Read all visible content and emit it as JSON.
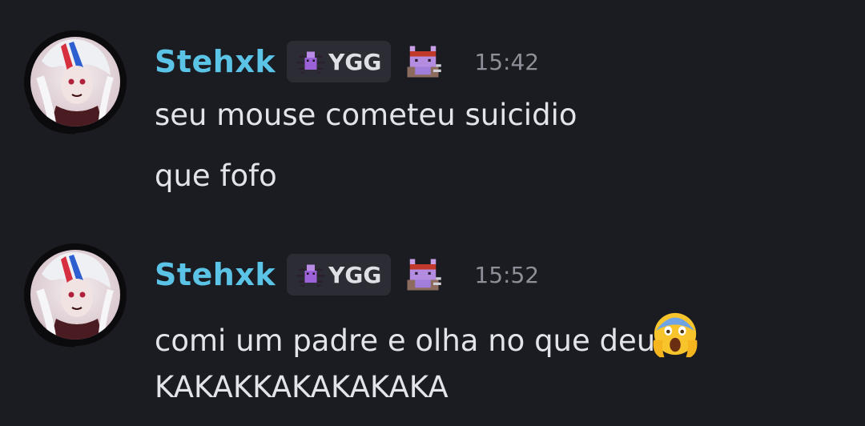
{
  "messages": [
    {
      "username": "Stehxk",
      "tag": {
        "label": "YGG",
        "icon": "spider-icon"
      },
      "decoration_icon": "pixel-creature-icon",
      "timestamp": "15:42",
      "lines": [
        {
          "text": "seu mouse cometeu suicidio"
        },
        {
          "text": "que fofo"
        }
      ]
    },
    {
      "username": "Stehxk",
      "tag": {
        "label": "YGG",
        "icon": "spider-icon"
      },
      "decoration_icon": "pixel-creature-icon",
      "timestamp": "15:52",
      "lines": [
        {
          "text": "comi um padre e olha no que deu",
          "emoji": "screaming-face-emoji"
        },
        {
          "text": "KAKAKKAKAKAKAKA"
        }
      ]
    }
  ],
  "colors": {
    "background": "#1b1c21",
    "username": "#5ac3e6",
    "message_text": "#e3e4ea",
    "timestamp": "#8d8f99",
    "tag_background": "#2c2d34"
  }
}
